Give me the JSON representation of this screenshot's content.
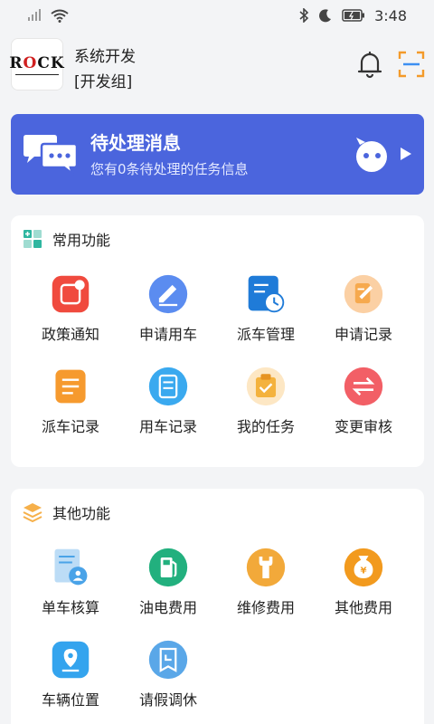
{
  "status": {
    "time": "3:48"
  },
  "header": {
    "logo_text_1": "R",
    "logo_text_2": "O",
    "logo_text_3": "CK",
    "user_name": "系统开发",
    "user_group": "[开发组]"
  },
  "banner": {
    "title": "待处理消息",
    "subtitle": "您有0条待处理的任务信息"
  },
  "common": {
    "title": "常用功能",
    "items": [
      {
        "label": "政策通知",
        "icon": "policy-notice-icon",
        "color": "#f04a3e"
      },
      {
        "label": "申请用车",
        "icon": "apply-car-icon",
        "color": "#5b8cf0"
      },
      {
        "label": "派车管理",
        "icon": "dispatch-manage-icon",
        "color": "#1f7bd8"
      },
      {
        "label": "申请记录",
        "icon": "apply-record-icon",
        "color": "#f6a94e"
      },
      {
        "label": "派车记录",
        "icon": "dispatch-record-icon",
        "color": "#f69a2e"
      },
      {
        "label": "用车记录",
        "icon": "use-record-icon",
        "color": "#3aa9ef"
      },
      {
        "label": "我的任务",
        "icon": "my-task-icon",
        "color": "#f4b23d"
      },
      {
        "label": "变更审核",
        "icon": "change-review-icon",
        "color": "#f25f66"
      }
    ]
  },
  "other": {
    "title": "其他功能",
    "items": [
      {
        "label": "单车核算",
        "icon": "vehicle-accounting-icon",
        "color": "#4aa3e8"
      },
      {
        "label": "油电费用",
        "icon": "fuel-cost-icon",
        "color": "#22b07e"
      },
      {
        "label": "维修费用",
        "icon": "repair-cost-icon",
        "color": "#f2a93a"
      },
      {
        "label": "其他费用",
        "icon": "other-cost-icon",
        "color": "#f29a1e"
      },
      {
        "label": "车辆位置",
        "icon": "vehicle-location-icon",
        "color": "#34a4ee"
      },
      {
        "label": "请假调休",
        "icon": "leave-icon",
        "color": "#5aa7e8"
      }
    ]
  }
}
